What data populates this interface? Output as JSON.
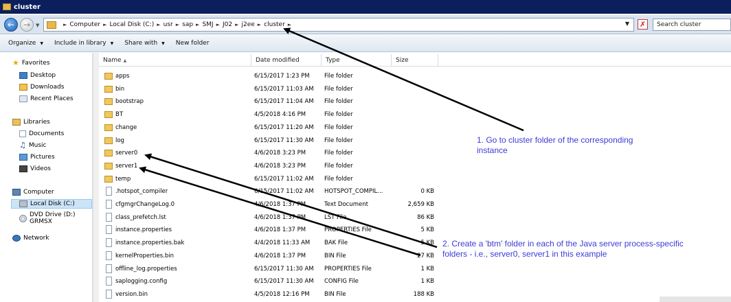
{
  "window": {
    "title": "cluster"
  },
  "address": {
    "breadcrumbs": [
      "Computer",
      "Local Disk (C:)",
      "usr",
      "sap",
      "SMJ",
      "J02",
      "j2ee",
      "cluster"
    ]
  },
  "search": {
    "placeholder": "Search cluster"
  },
  "toolbar": {
    "organize": "Organize",
    "include_in_library": "Include in library",
    "share_with": "Share with",
    "new_folder": "New folder"
  },
  "nav": {
    "favorites": {
      "label": "Favorites",
      "items": [
        "Desktop",
        "Downloads",
        "Recent Places"
      ]
    },
    "libraries": {
      "label": "Libraries",
      "items": [
        "Documents",
        "Music",
        "Pictures",
        "Videos"
      ]
    },
    "computer": {
      "label": "Computer",
      "items": [
        "Local Disk (C:)",
        "DVD Drive (D:) GRMSX"
      ]
    },
    "network": {
      "label": "Network"
    }
  },
  "columns": {
    "name": "Name",
    "date": "Date modified",
    "type": "Type",
    "size": "Size"
  },
  "files": [
    {
      "name": "apps",
      "date": "6/15/2017 1:23 PM",
      "type": "File folder",
      "size": "",
      "kind": "folder"
    },
    {
      "name": "bin",
      "date": "6/15/2017 11:03 AM",
      "type": "File folder",
      "size": "",
      "kind": "folder"
    },
    {
      "name": "bootstrap",
      "date": "6/15/2017 11:04 AM",
      "type": "File folder",
      "size": "",
      "kind": "folder"
    },
    {
      "name": "BT",
      "date": "4/5/2018 4:16 PM",
      "type": "File folder",
      "size": "",
      "kind": "folder"
    },
    {
      "name": "change",
      "date": "6/15/2017 11:20 AM",
      "type": "File folder",
      "size": "",
      "kind": "folder"
    },
    {
      "name": "log",
      "date": "6/15/2017 11:30 AM",
      "type": "File folder",
      "size": "",
      "kind": "folder"
    },
    {
      "name": "server0",
      "date": "4/6/2018 3:23 PM",
      "type": "File folder",
      "size": "",
      "kind": "folder"
    },
    {
      "name": "server1",
      "date": "4/6/2018 3:23 PM",
      "type": "File folder",
      "size": "",
      "kind": "folder"
    },
    {
      "name": "temp",
      "date": "6/15/2017 11:02 AM",
      "type": "File folder",
      "size": "",
      "kind": "folder"
    },
    {
      "name": ".hotspot_compiler",
      "date": "6/15/2017 11:02 AM",
      "type": "HOTSPOT_COMPIL...",
      "size": "0 KB",
      "kind": "file"
    },
    {
      "name": "cfgmgrChangeLog.0",
      "date": "4/6/2018 1:37 PM",
      "type": "Text Document",
      "size": "2,659 KB",
      "kind": "file"
    },
    {
      "name": "class_prefetch.lst",
      "date": "4/6/2018 1:37 PM",
      "type": "LST File",
      "size": "86 KB",
      "kind": "file"
    },
    {
      "name": "instance.properties",
      "date": "4/6/2018 1:37 PM",
      "type": "PROPERTIES File",
      "size": "5 KB",
      "kind": "file"
    },
    {
      "name": "instance.properties.bak",
      "date": "4/4/2018 11:33 AM",
      "type": "BAK File",
      "size": "5 KB",
      "kind": "file"
    },
    {
      "name": "kernelProperties.bin",
      "date": "4/6/2018 1:37 PM",
      "type": "BIN File",
      "size": "27 KB",
      "kind": "file"
    },
    {
      "name": "offline_log.properties",
      "date": "6/15/2017 11:30 AM",
      "type": "PROPERTIES File",
      "size": "1 KB",
      "kind": "file"
    },
    {
      "name": "saplogging.config",
      "date": "6/15/2017 11:30 AM",
      "type": "CONFIG File",
      "size": "1 KB",
      "kind": "file"
    },
    {
      "name": "version.bin",
      "date": "4/5/2018 12:16 PM",
      "type": "BIN File",
      "size": "188 KB",
      "kind": "file"
    }
  ],
  "annotations": {
    "step1_line1": "1. Go to cluster folder of the corresponding",
    "step1_line2": "instance",
    "step2_line1": "2. Create a 'btm' folder in each of the Java server process-specific",
    "step2_line2": "folders - i.e., server0, server1 in this example"
  },
  "colors": {
    "annotation_text": "#3b3bd6",
    "title_bar": "#0a1f5c",
    "arrow": "#000000"
  }
}
